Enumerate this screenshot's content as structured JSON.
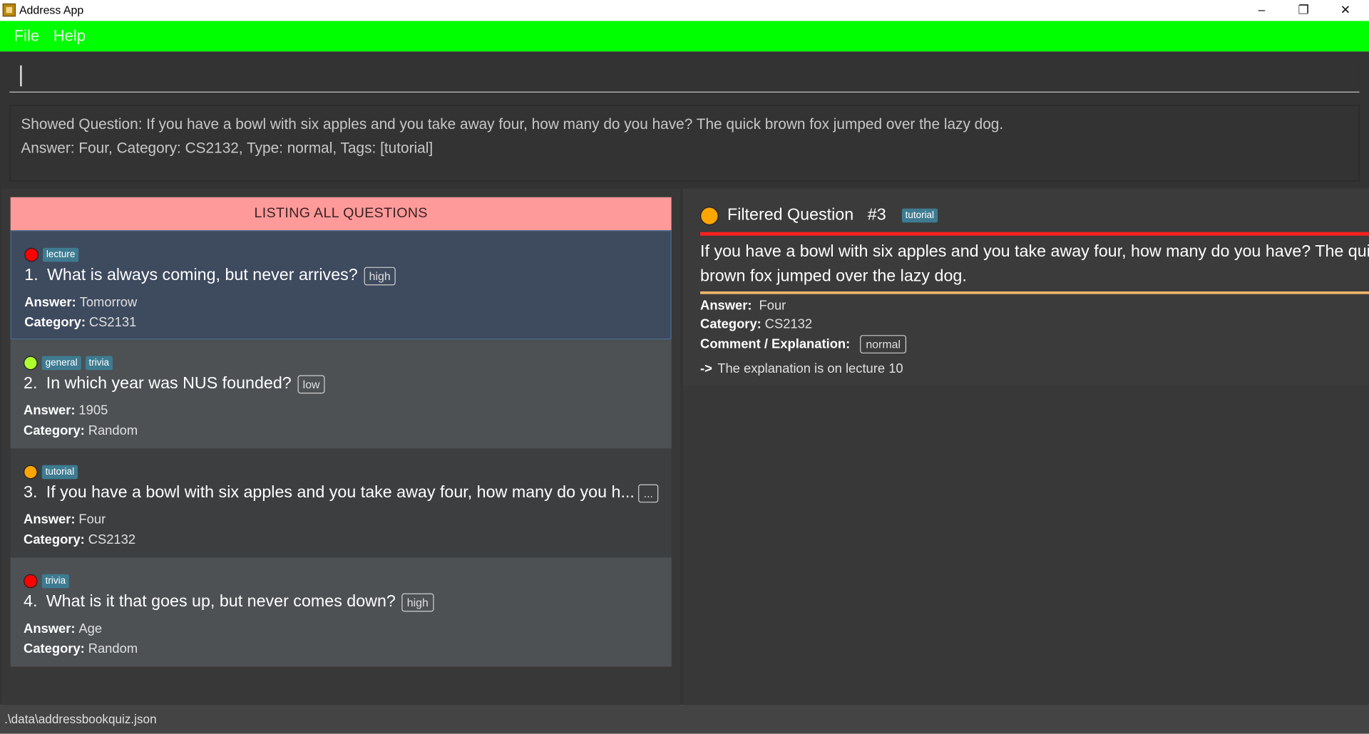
{
  "window": {
    "title": "Address App",
    "minimize": "–",
    "maximize": "❐",
    "close": "✕"
  },
  "menu": {
    "file": "File",
    "help": "Help"
  },
  "command": {
    "value": ""
  },
  "result": {
    "line1": "Showed Question: If you have a bowl with six apples and you take away four, how many do you have? The quick brown fox jumped over the lazy dog.",
    "line2": "Answer: Four, Category: CS2132, Type: normal, Tags: [tutorial]"
  },
  "list": {
    "header": "LISTING ALL QUESTIONS",
    "answer_label": "Answer:",
    "category_label": "Category:",
    "items": [
      {
        "num": "1.",
        "dot_color": "#ff0000",
        "tags": [
          "lecture"
        ],
        "question": "What is always coming, but never arrives?",
        "difficulty": "high",
        "answer": "Tomorrow",
        "category": "CS2131"
      },
      {
        "num": "2.",
        "dot_color": "#adff2f",
        "tags": [
          "general",
          "trivia"
        ],
        "question": "In which year was NUS founded?",
        "difficulty": "low",
        "answer": "1905",
        "category": "Random"
      },
      {
        "num": "3.",
        "dot_color": "#ffa500",
        "tags": [
          "tutorial"
        ],
        "question": "If you have a bowl with six apples and you take away four, how many do you h...",
        "difficulty": "...",
        "answer": "Four",
        "category": "CS2132"
      },
      {
        "num": "4.",
        "dot_color": "#ff0000",
        "tags": [
          "trivia"
        ],
        "question": "What is it that goes up, but never comes down?",
        "difficulty": "high",
        "answer": "Age",
        "category": "Random"
      }
    ]
  },
  "detail": {
    "title": "Filtered Question",
    "number": "#3",
    "tag": "tutorial",
    "dot_color": "#ffa500",
    "question_line1": "If you have a bowl with six apples and you take away four, how many do you have? The quic",
    "question_line2": "brown fox jumped over the lazy dog.",
    "answer_label": "Answer:",
    "answer": "Four",
    "category_label": "Category:",
    "category": "CS2132",
    "comment_label": "Comment / Explanation:",
    "type": "normal",
    "arrow": "->",
    "explanation": "The explanation is on lecture 10"
  },
  "status": {
    "path": ".\\data\\addressbookquiz.json"
  },
  "colors": {
    "menubar": "#00ff00",
    "header": "#ff9a9a",
    "tag": "#3e7b91",
    "accent_red": "#ff2020",
    "accent_orange": "#f3b76a"
  }
}
